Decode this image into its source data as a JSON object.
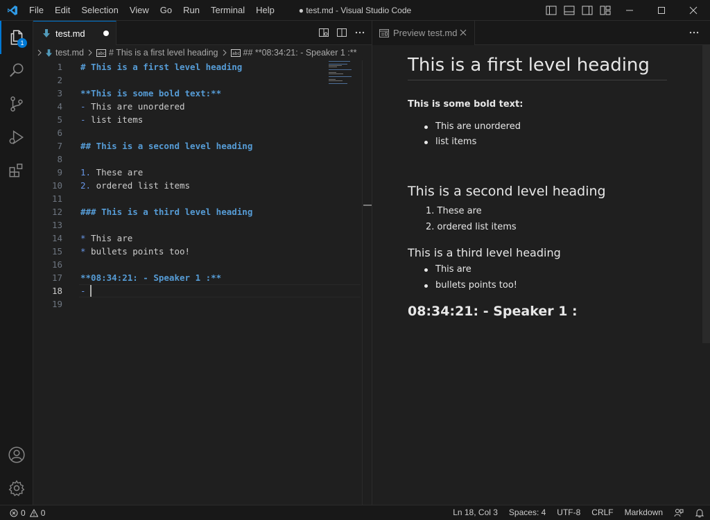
{
  "titlebar": {
    "menus": [
      "File",
      "Edit",
      "Selection",
      "View",
      "Go",
      "Run",
      "Terminal",
      "Help"
    ],
    "window_title": "● test.md - Visual Studio Code"
  },
  "activity_bar": {
    "explorer_badge": "1"
  },
  "editor": {
    "tab_label": "test.md",
    "breadcrumb": {
      "file": "test.md",
      "heading": "# This is a first level heading",
      "subheading": "## **08:34:21: - Speaker 1 :**"
    },
    "lines": [
      {
        "no": "1",
        "text": "# This is a first level heading"
      },
      {
        "no": "2",
        "text": ""
      },
      {
        "no": "3",
        "text": "**This is some bold text:**"
      },
      {
        "no": "4",
        "marker": "-",
        "text": " This are unordered"
      },
      {
        "no": "5",
        "marker": "-",
        "text": " list items"
      },
      {
        "no": "6",
        "text": ""
      },
      {
        "no": "7",
        "text": "## This is a second level heading"
      },
      {
        "no": "8",
        "text": ""
      },
      {
        "no": "9",
        "marker": "1.",
        "text": " These are"
      },
      {
        "no": "10",
        "marker": "2.",
        "text": " ordered list items"
      },
      {
        "no": "11",
        "text": ""
      },
      {
        "no": "12",
        "text": "### This is a third level heading"
      },
      {
        "no": "13",
        "text": ""
      },
      {
        "no": "14",
        "marker": "*",
        "text": " This are"
      },
      {
        "no": "15",
        "marker": "*",
        "text": " bullets points too!"
      },
      {
        "no": "16",
        "text": ""
      },
      {
        "no": "17",
        "text": "**08:34:21: - Speaker 1 :**"
      },
      {
        "no": "18",
        "marker": "-",
        "text": " "
      },
      {
        "no": "19",
        "text": ""
      }
    ]
  },
  "preview": {
    "tab_label": "Preview test.md",
    "h1": "This is a first level heading",
    "bold": "This is some bold text:",
    "unordered": [
      "This are unordered",
      "list items"
    ],
    "h2": "This is a second level heading",
    "ordered": [
      "1. These are",
      "2. ordered list items"
    ],
    "h3": "This is a third level heading",
    "bullets": [
      "This are",
      "bullets points too!"
    ],
    "speaker": "08:34:21: - Speaker 1 :"
  },
  "statusbar": {
    "errors": "0",
    "warnings": "0",
    "position": "Ln 18, Col 3",
    "spaces": "Spaces: 4",
    "encoding": "UTF-8",
    "eol": "CRLF",
    "language": "Markdown"
  },
  "colors": {
    "accent": "#0078d4",
    "markdown_heading": "#569cd6",
    "markdown_icon": "#519aba"
  }
}
